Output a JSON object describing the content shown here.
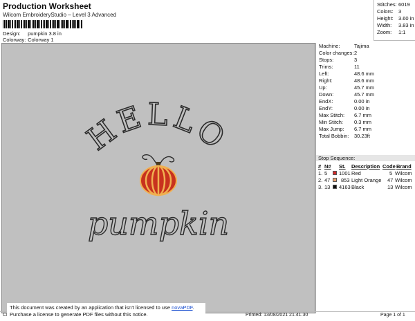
{
  "header": {
    "title": "Production Worksheet",
    "subtitle": "Wilcom EmbroideryStudio – Level 3 Advanced",
    "design_label": "Design:",
    "design_value": "pumpkin 3.8 in",
    "colorway_label": "Colorway:",
    "colorway_value": "Colorway 1"
  },
  "stats": [
    {
      "label": "Stitches:",
      "value": "6019"
    },
    {
      "label": "Colors:",
      "value": "3"
    },
    {
      "label": "Height:",
      "value": "3.60 in"
    },
    {
      "label": "Width:",
      "value": "3.83 in"
    },
    {
      "label": "Zoom:",
      "value": "1:1"
    }
  ],
  "machine_info": [
    {
      "label": "Machine:",
      "value": "Tajima"
    },
    {
      "label": "Color changes:",
      "value": "2"
    },
    {
      "label": "Stops:",
      "value": "3"
    },
    {
      "label": "Trims:",
      "value": "11"
    },
    {
      "label": "Left:",
      "value": "48.6 mm"
    },
    {
      "label": "Right:",
      "value": "48.6 mm"
    },
    {
      "label": "Up:",
      "value": "45.7 mm"
    },
    {
      "label": "Down:",
      "value": "45.7 mm"
    },
    {
      "label": "EndX:",
      "value": "0.00 in"
    },
    {
      "label": "EndY:",
      "value": "0.00 in"
    },
    {
      "label": "Max Stitch:",
      "value": "6.7 mm"
    },
    {
      "label": "Min Stitch:",
      "value": "0.3 mm"
    },
    {
      "label": "Max Jump:",
      "value": "6.7 mm"
    },
    {
      "label": "Total Bobbin:",
      "value": "30.23ft"
    }
  ],
  "stop_sequence": {
    "title": "Stop Sequence:",
    "columns": [
      "#",
      "N#",
      "St.",
      "Description",
      "Code",
      "Brand"
    ],
    "rows": [
      {
        "num": "1.",
        "needle": "5",
        "color": "#d42a2a",
        "stitches": "1001",
        "description": "Red",
        "code": "5",
        "brand": "Wilcom"
      },
      {
        "num": "2.",
        "needle": "47",
        "color": "#e8a070",
        "stitches": "853",
        "description": "Light Orange",
        "code": "47",
        "brand": "Wilcom"
      },
      {
        "num": "3.",
        "needle": "13",
        "color": "#111111",
        "stitches": "4163",
        "description": "Black",
        "code": "13",
        "brand": "Wilcom"
      }
    ]
  },
  "design": {
    "word_top": "HELLO",
    "word_bottom": "pumpkin"
  },
  "notice": {
    "line1_prefix": "This document was created by an application that isn't licensed to use ",
    "link": "novaPDF",
    "line1_suffix": ".",
    "line2": "Purchase a license to generate PDF files without this notice."
  },
  "footer": {
    "left": "Cr",
    "printed": "Printed: 13/08/2021 21.41.30",
    "page": "Page 1 of 1"
  },
  "colors": {
    "canvas": "#c0c0c0",
    "thread_black": "#2b2b2b",
    "thread_red": "#c8321e",
    "thread_orange": "#f0b050"
  }
}
